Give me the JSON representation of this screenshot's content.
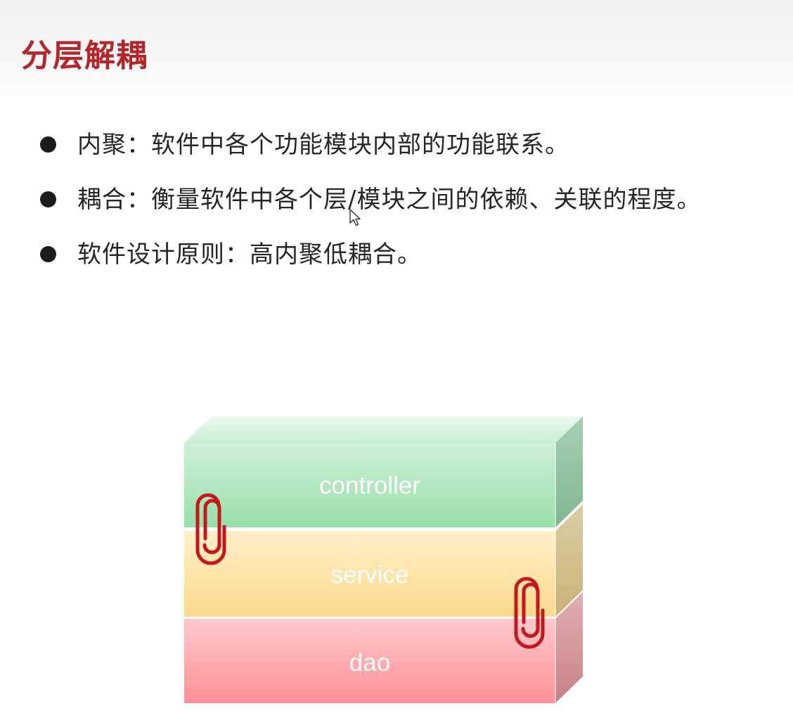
{
  "title": "分层解耦",
  "bullets": [
    {
      "text": "内聚：软件中各个功能模块内部的功能联系。"
    },
    {
      "text": "耦合：衡量软件中各个层/模块之间的依赖、关联的程度。"
    },
    {
      "text": "软件设计原则：高内聚低耦合。"
    }
  ],
  "layers": [
    {
      "label": "controller",
      "color": "#a6e3b4"
    },
    {
      "label": "service",
      "color": "#fde39c"
    },
    {
      "label": "dao",
      "color": "#ff9ea2"
    }
  ],
  "icons": {
    "bullet": "filled-circle",
    "clip": "paperclip-icon",
    "cursor": "mouse-pointer-icon"
  },
  "colors": {
    "title": "#b3272b",
    "clip": "#c8161d"
  }
}
